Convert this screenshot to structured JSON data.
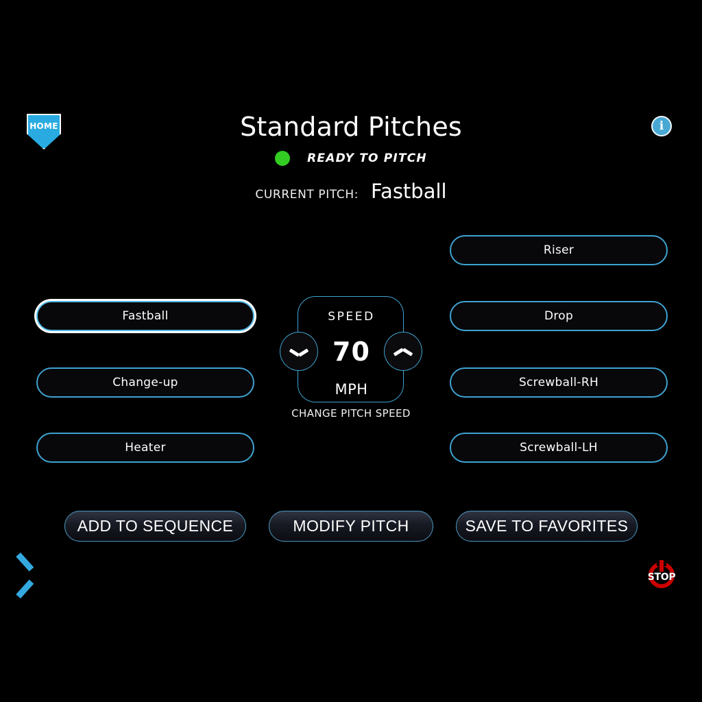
{
  "header": {
    "title": "Standard Pitches",
    "home_label": "HOME",
    "info_label": "i",
    "status_text": "READY TO PITCH",
    "status_color": "#33cc22"
  },
  "current_pitch": {
    "label": "CURRENT PITCH:",
    "value": "Fastball"
  },
  "pitches_left": [
    {
      "label": "Fastball",
      "selected": true
    },
    {
      "label": "Change-up",
      "selected": false
    },
    {
      "label": "Heater",
      "selected": false
    }
  ],
  "pitches_right": [
    {
      "label": "Riser",
      "selected": false
    },
    {
      "label": "Drop",
      "selected": false
    },
    {
      "label": "Screwball-RH",
      "selected": false
    },
    {
      "label": "Screwball-LH",
      "selected": false
    }
  ],
  "speed": {
    "label": "SPEED",
    "value": "70",
    "unit": "MPH",
    "caption": "CHANGE PITCH SPEED",
    "decrease_icon": "chevron-down-icon",
    "increase_icon": "chevron-up-icon"
  },
  "actions": [
    {
      "label": "ADD TO SEQUENCE"
    },
    {
      "label": "MODIFY PITCH"
    },
    {
      "label": "SAVE TO FAVORITES"
    }
  ],
  "footer": {
    "back_icon": "chevron-left-icon",
    "stop_label": "STOP",
    "stop_color": "#cc0000"
  },
  "theme": {
    "accent": "#3fa3d1",
    "background": "#000000",
    "text": "#ffffff"
  }
}
